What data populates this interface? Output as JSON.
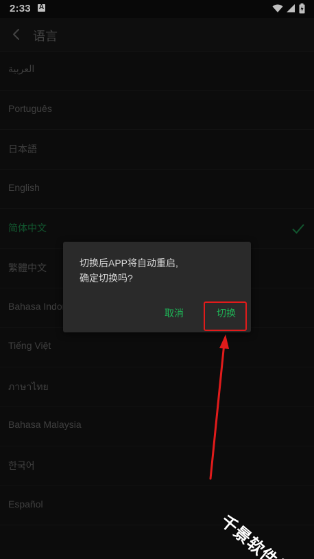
{
  "status_bar": {
    "time": "2:33",
    "notification_letter": "A"
  },
  "header": {
    "title": "语言"
  },
  "languages": [
    {
      "label": "العربية",
      "selected": false
    },
    {
      "label": "Português",
      "selected": false
    },
    {
      "label": "日本語",
      "selected": false
    },
    {
      "label": "English",
      "selected": false
    },
    {
      "label": "简体中文",
      "selected": true
    },
    {
      "label": "繁體中文",
      "selected": false
    },
    {
      "label": "Bahasa Indonesia",
      "selected": false
    },
    {
      "label": "Tiếng Việt",
      "selected": false
    },
    {
      "label": "ภาษาไทย",
      "selected": false
    },
    {
      "label": "Bahasa Malaysia",
      "selected": false
    },
    {
      "label": "한국어",
      "selected": false
    },
    {
      "label": "Español",
      "selected": false
    }
  ],
  "dialog": {
    "message": "切换后APP将自动重启,\n确定切换吗?",
    "cancel_label": "取消",
    "confirm_label": "切换"
  },
  "watermark": "千景软件站",
  "colors": {
    "accent_green": "#1fb256",
    "selected_green": "#18743f",
    "highlight_red": "#e11b1b",
    "background": "#111111",
    "dialog_background": "#2a2a2a"
  },
  "icons": {
    "back": "chevron-left-icon",
    "selected": "check-icon",
    "wifi": "wifi-icon",
    "signal": "signal-icon",
    "battery": "battery-icon"
  }
}
